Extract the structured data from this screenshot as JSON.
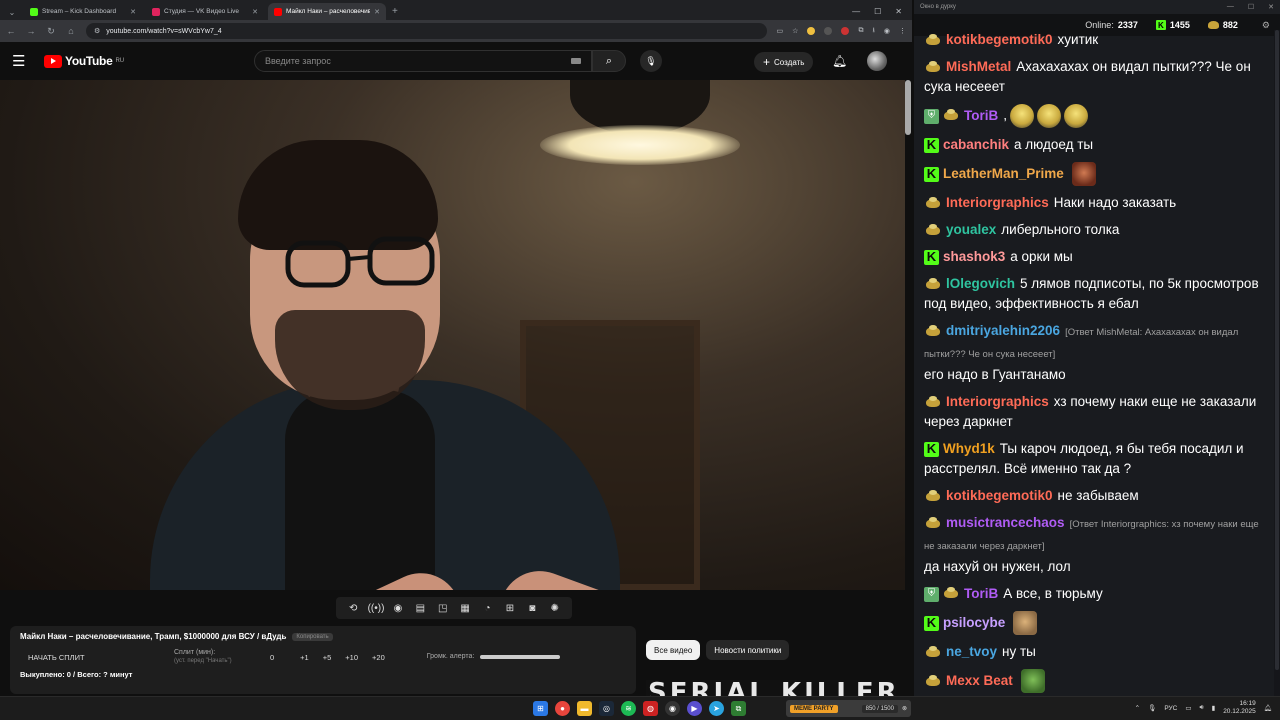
{
  "browser": {
    "tabs": [
      {
        "label": "Stream – Kick Dashboard",
        "favicon_color": "#53fc18",
        "active": false
      },
      {
        "label": "Студия — VK Видео Live",
        "favicon_color": "#e0245e",
        "active": false
      },
      {
        "label": "Майкл Наки – расчеловечиван...",
        "favicon_color": "#ff0000",
        "active": true
      }
    ],
    "new_tab_symbol": "+",
    "url": "youtube.com/watch?v=sWVcbYw7_4"
  },
  "youtube": {
    "logo_text": "YouTube",
    "region": "RU",
    "search_placeholder": "Введите запрос",
    "create_label": "Создать"
  },
  "video_toolbar": {
    "icons": [
      "loop-icon",
      "broadcast-icon",
      "eye-icon",
      "clapper-icon",
      "pip-icon",
      "film-icon",
      "speed-icon",
      "add-icon",
      "camera-icon",
      "gear-icon"
    ]
  },
  "info": {
    "title": "Майкл Наки – расчеловечивание, Трамп, $1000000 для ВСУ / вДудь",
    "badge": "Копировать",
    "start_split": "НАЧАТЬ СПЛИТ",
    "split_label": "Сплит (мин):",
    "split_hint": "(уст. перед \"Начать\")",
    "split_value": "0",
    "steps": [
      "+1",
      "+5",
      "+10",
      "+20"
    ],
    "alert_label": "Громк. алерта:",
    "alert_volume": 1.0,
    "bought": "Выкуплено: 0 / Всего: ? минут"
  },
  "chips": [
    {
      "label": "Все видео",
      "active": true
    },
    {
      "label": "Новости политики",
      "active": false
    }
  ],
  "thumb_text": "SERIAL KILLER",
  "chat": {
    "window_title": "Окно в дурку",
    "online_label": "Online:",
    "online_count": "2337",
    "kick_count": "1455",
    "vk_count": "882",
    "messages": [
      {
        "icons": [
          "vk"
        ],
        "nick": "kotikbegemotik0",
        "color": "#ff6b57",
        "reply": "",
        "text": "хуитик"
      },
      {
        "icons": [
          "vk"
        ],
        "nick": "MishMetal",
        "color": "#ff6b57",
        "reply": "",
        "text": "Ахахахахах он видал пытки??? Че он сука несееет"
      },
      {
        "icons": [
          "shield",
          "vk"
        ],
        "nick": "ToriB",
        "color": "#b05cf5",
        "reply": "",
        "text": ",",
        "emotes": [
          "yellow",
          "yellow",
          "yellow"
        ]
      },
      {
        "icons": [
          "k"
        ],
        "nick": "cabanchik",
        "color": "#ff7f7f",
        "reply": "",
        "text": "а людоед ты"
      },
      {
        "icons": [
          "k"
        ],
        "nick": "LeatherMan_Prime",
        "color": "#f0a84a",
        "reply": "",
        "text": "",
        "emotes": [
          "face"
        ]
      },
      {
        "icons": [
          "vk"
        ],
        "nick": "Interiorgraphics",
        "color": "#ff6b57",
        "reply": "",
        "text": "Наки надо заказать"
      },
      {
        "icons": [
          "vk"
        ],
        "nick": "youalex",
        "color": "#2fc4a0",
        "reply": "",
        "text": "либерльного толка"
      },
      {
        "icons": [
          "k"
        ],
        "nick": "shashok3",
        "color": "#ff9a9a",
        "reply": "",
        "text": "а орки мы"
      },
      {
        "icons": [
          "vk"
        ],
        "nick": "lOlegovich",
        "color": "#2fc4a0",
        "reply": "",
        "text": "5 лямов подписоты, по 5к просмотров под видео, эффективность я ебал"
      },
      {
        "icons": [
          "vk"
        ],
        "nick": "dmitriyalehin2206",
        "color": "#4aa6e0",
        "reply": "[Ответ MishMetal: Ахахахахах он видал пытки??? Че он сука несееет]",
        "text": "его надо в Гуантанамо"
      },
      {
        "icons": [
          "vk"
        ],
        "nick": "Interiorgraphics",
        "color": "#ff6b57",
        "reply": "",
        "text": "хз почему наки еще не заказали через даркнет"
      },
      {
        "icons": [
          "k"
        ],
        "nick": "Whyd1k",
        "color": "#f0a020",
        "reply": "",
        "text": "Ты кароч людоед, я бы тебя посадил и расстрелял. Всё именно так да ?"
      },
      {
        "icons": [
          "vk"
        ],
        "nick": "kotikbegemotik0",
        "color": "#ff6b57",
        "reply": "",
        "text": "не забываем"
      },
      {
        "icons": [
          "vk"
        ],
        "nick": "musictrancechaos",
        "color": "#b05cf5",
        "reply": "[Ответ Interiorgraphics: хз почему наки еще не заказали через даркнет]",
        "text": "да нахуй он нужен, лол"
      },
      {
        "icons": [
          "shield",
          "vk"
        ],
        "nick": "ToriB",
        "color": "#b05cf5",
        "reply": "",
        "text": "А все, в тюрьму"
      },
      {
        "icons": [
          "k"
        ],
        "nick": "psilocybe",
        "color": "#c7a0ff",
        "reply": "",
        "text": "",
        "emotes": [
          "cat"
        ]
      },
      {
        "icons": [
          "vk"
        ],
        "nick": "ne_tvoy",
        "color": "#4aa6e0",
        "reply": "",
        "text": "ну ты"
      },
      {
        "icons": [
          "vk"
        ],
        "nick": "Mexx Beat",
        "color": "#ff6b57",
        "reply": "",
        "text": "",
        "emotes": [
          "frog"
        ]
      }
    ]
  },
  "taskbar": {
    "widget_label": "МЕМЕ PARTY",
    "widget_progress": "850 / 1500",
    "lang": "РУС",
    "time": "16:19",
    "date": "20.12.2025"
  }
}
